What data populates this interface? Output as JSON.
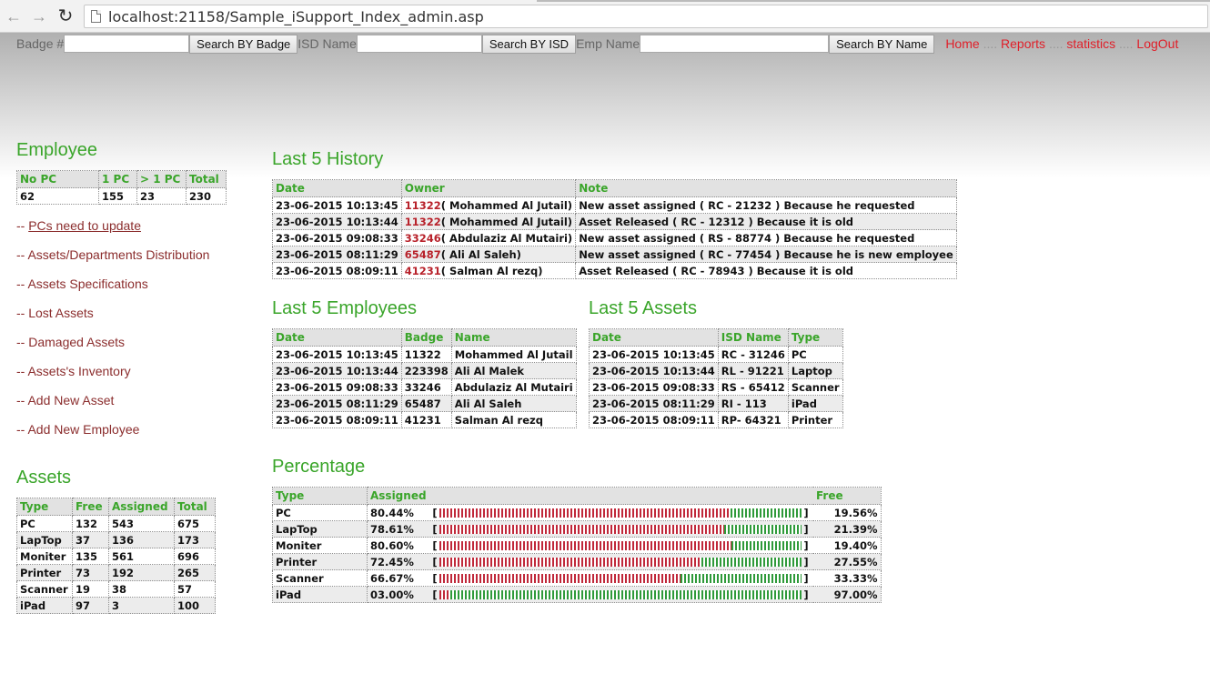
{
  "browser": {
    "url": "localhost:21158/Sample_iSupport_Index_admin.asp"
  },
  "search": {
    "badge_label": "Badge #",
    "badge_button": "Search BY Badge",
    "isd_label": "ISD Name",
    "isd_button": "Search BY ISD",
    "emp_label": "Emp Name",
    "emp_button": "Search BY Name"
  },
  "toplinks": {
    "home": "Home",
    "reports": "Reports",
    "statistics": "statistics",
    "logout": "LogOut",
    "sep": "...."
  },
  "employee": {
    "title": "Employee",
    "headers": [
      "No PC",
      "1 PC",
      "> 1 PC",
      "Total"
    ],
    "values": [
      "62",
      "155",
      "23",
      "230"
    ]
  },
  "links": [
    {
      "prefix": "-- ",
      "label": "PCs need to update"
    },
    {
      "prefix": "-- ",
      "label": "Assets/Departments Distribution"
    },
    {
      "prefix": "-- ",
      "label": "Assets Specifications"
    },
    {
      "prefix": "-- ",
      "label": "Lost Assets"
    },
    {
      "prefix": "-- ",
      "label": "Damaged Assets"
    },
    {
      "prefix": "-- ",
      "label": "Assets's Inventory"
    },
    {
      "prefix": "-- ",
      "label": "Add New Asset"
    },
    {
      "prefix": "-- ",
      "label": "Add New Employee"
    }
  ],
  "assets": {
    "title": "Assets",
    "headers": [
      "Type",
      "Free",
      "Assigned",
      "Total"
    ],
    "rows": [
      [
        "PC",
        "132",
        "543",
        "675"
      ],
      [
        "LapTop",
        "37",
        "136",
        "173"
      ],
      [
        "Moniter",
        "135",
        "561",
        "696"
      ],
      [
        "Printer",
        "73",
        "192",
        "265"
      ],
      [
        "Scanner",
        "19",
        "38",
        "57"
      ],
      [
        "iPad",
        "97",
        "3",
        "100"
      ]
    ]
  },
  "history": {
    "title": "Last 5 History",
    "headers": [
      "Date",
      "Owner",
      "Note"
    ],
    "rows": [
      {
        "date": "23-06-2015 10:13:45",
        "badge": "11322",
        "name": "( Mohammed Al Jutail)",
        "note": "New asset assigned ( RC - 21232 ) Because he requested"
      },
      {
        "date": "23-06-2015 10:13:44",
        "badge": "11322",
        "name": "( Mohammed Al Jutail)",
        "note": "Asset Released ( RC - 12312 ) Because it is old"
      },
      {
        "date": "23-06-2015 09:08:33",
        "badge": "33246",
        "name": "( Abdulaziz Al Mutairi)",
        "note": "New asset assigned ( RS - 88774 ) Because he requested"
      },
      {
        "date": "23-06-2015 08:11:29",
        "badge": "65487",
        "name": "( Ali Al Saleh)",
        "note": "New asset assigned ( RC - 77454 ) Because he is new employee"
      },
      {
        "date": "23-06-2015 08:09:11",
        "badge": "41231",
        "name": "( Salman Al rezq)",
        "note": "Asset Released ( RC - 78943 ) Because it is old"
      }
    ]
  },
  "employees": {
    "title": "Last 5 Employees",
    "headers": [
      "Date",
      "Badge",
      "Name"
    ],
    "rows": [
      {
        "date": "23-06-2015 10:13:45",
        "badge": "11322",
        "name": "Mohammed Al Jutail"
      },
      {
        "date": "23-06-2015 10:13:44",
        "badge": "223398",
        "name": "Ali Al Malek"
      },
      {
        "date": "23-06-2015 09:08:33",
        "badge": "33246",
        "name": "Abdulaziz Al Mutairi"
      },
      {
        "date": "23-06-2015 08:11:29",
        "badge": "65487",
        "name": "Ali Al Saleh"
      },
      {
        "date": "23-06-2015 08:09:11",
        "badge": "41231",
        "name": "Salman Al rezq"
      }
    ]
  },
  "last_assets": {
    "title": "Last 5 Assets",
    "headers": [
      "Date",
      "ISD Name",
      "Type"
    ],
    "rows": [
      {
        "date": "23-06-2015 10:13:45",
        "isd": "RC - 31246",
        "type": "PC"
      },
      {
        "date": "23-06-2015 10:13:44",
        "isd": "RL - 91221",
        "type": "Laptop"
      },
      {
        "date": "23-06-2015 09:08:33",
        "isd": "RS - 65412",
        "type": "Scanner"
      },
      {
        "date": "23-06-2015 08:11:29",
        "isd": "RI - 113",
        "type": "iPad"
      },
      {
        "date": "23-06-2015 08:09:11",
        "isd": "RP- 64321",
        "type": "Printer"
      }
    ]
  },
  "percentage": {
    "title": "Percentage",
    "headers": [
      "Type",
      "Assigned",
      "Free"
    ],
    "open_bracket": "[",
    "close_bracket": "]",
    "rows": [
      {
        "type": "PC",
        "assigned": "80.44%",
        "free": "19.56%",
        "fraction": 0.8044
      },
      {
        "type": "LapTop",
        "assigned": "78.61%",
        "free": "21.39%",
        "fraction": 0.7861
      },
      {
        "type": "Moniter",
        "assigned": "80.60%",
        "free": "19.40%",
        "fraction": 0.806
      },
      {
        "type": "Printer",
        "assigned": "72.45%",
        "free": "27.55%",
        "fraction": 0.7245
      },
      {
        "type": "Scanner",
        "assigned": "66.67%",
        "free": "33.33%",
        "fraction": 0.6667
      },
      {
        "type": "iPad",
        "assigned": "03.00%",
        "free": "97.00%",
        "fraction": 0.03
      }
    ]
  },
  "colors": {
    "heading_green": "#3aa52a",
    "link_red": "#e0202a",
    "badge_red": "#b8222b",
    "assigned_bar": "#c0283a",
    "free_bar": "#2f9a3a"
  }
}
